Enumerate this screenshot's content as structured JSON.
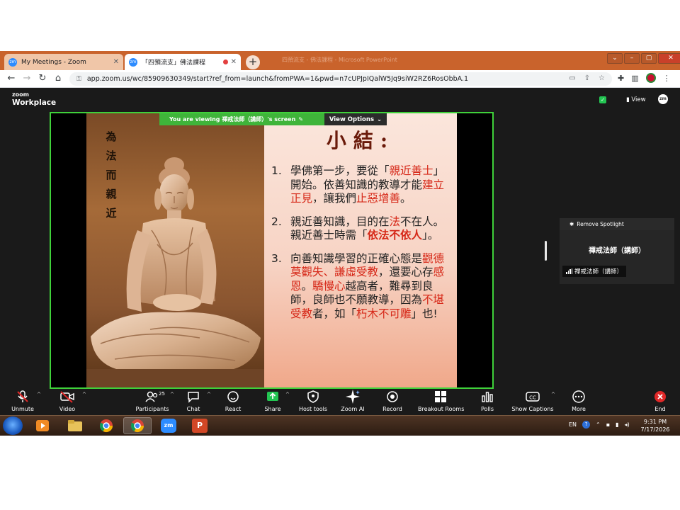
{
  "browser": {
    "tabs": [
      {
        "label": "My Meetings - Zoom",
        "favicon": "zm",
        "active": false
      },
      {
        "label": "「四預流支」佛法課程",
        "favicon": "zm",
        "active": true
      }
    ],
    "window_title": "四預流支 - 佛法課程 - Microsoft PowerPoint",
    "url": "app.zoom.us/wc/85909630349/start?ref_from=launch&fromPWA=1&pwd=n7cUPJpIQalW5Jq9siW2RZ6RosObbA.1"
  },
  "zoom_header": {
    "brand_top": "zoom",
    "brand_bottom": "Workplace",
    "view_label": "View",
    "badge": "zm"
  },
  "share": {
    "viewing_banner": "You are viewing 禪戒法師（講師）'s screen",
    "view_options": "View Options"
  },
  "slide": {
    "vertical_text": [
      "為",
      "法",
      "而",
      "親",
      "近"
    ],
    "title": "小結:",
    "items": [
      {
        "num": "1.",
        "runs": [
          {
            "t": "學佛第一步，要從「",
            "c": "black"
          },
          {
            "t": "親近善士",
            "c": "red"
          },
          {
            "t": "」開始。依善知識的教導才能",
            "c": "black"
          },
          {
            "t": "建立正見",
            "c": "red"
          },
          {
            "t": "，讓我們",
            "c": "black"
          },
          {
            "t": "止惡增善",
            "c": "red"
          },
          {
            "t": "。",
            "c": "black"
          }
        ]
      },
      {
        "num": "2.",
        "runs": [
          {
            "t": "親近善知識，目的在",
            "c": "black"
          },
          {
            "t": "法",
            "c": "red"
          },
          {
            "t": "不在人。親近善士時需「",
            "c": "black"
          },
          {
            "t": "依法不依人",
            "c": "redb"
          },
          {
            "t": "」。",
            "c": "black"
          }
        ]
      },
      {
        "num": "3.",
        "runs": [
          {
            "t": "向善知識學習的正確心態是",
            "c": "black"
          },
          {
            "t": "觀德莫觀失、謙虛受教",
            "c": "red"
          },
          {
            "t": "，還要心存",
            "c": "black"
          },
          {
            "t": "感恩",
            "c": "red"
          },
          {
            "t": "。",
            "c": "black"
          },
          {
            "t": "驕慢心",
            "c": "red"
          },
          {
            "t": "越高者，難尋到良師，良師也不願教導，因為",
            "c": "black"
          },
          {
            "t": "不堪受教",
            "c": "red"
          },
          {
            "t": "者，如「",
            "c": "black"
          },
          {
            "t": "朽木不可雕",
            "c": "red"
          },
          {
            "t": "」也!",
            "c": "black"
          }
        ]
      }
    ]
  },
  "spotlight": {
    "remove_label": "Remove Spotlight",
    "tile_name": "禪戒法師（講師）",
    "label_name": "禪戒法師（講師）"
  },
  "toolbar": {
    "participant_count": "25",
    "buttons": [
      {
        "id": "unmute",
        "label": "Unmute",
        "icon": "mic-muted-icon"
      },
      {
        "id": "video",
        "label": "Video",
        "icon": "video-off-icon"
      },
      {
        "id": "participants",
        "label": "Participants",
        "icon": "participants-icon"
      },
      {
        "id": "chat",
        "label": "Chat",
        "icon": "chat-icon"
      },
      {
        "id": "react",
        "label": "React",
        "icon": "react-icon"
      },
      {
        "id": "share",
        "label": "Share",
        "icon": "share-icon"
      },
      {
        "id": "host-tools",
        "label": "Host tools",
        "icon": "host-tools-icon"
      },
      {
        "id": "zoom-ai",
        "label": "Zoom AI",
        "icon": "zoom-ai-icon"
      },
      {
        "id": "record",
        "label": "Record",
        "icon": "record-icon"
      },
      {
        "id": "breakout",
        "label": "Breakout Rooms",
        "icon": "breakout-icon"
      },
      {
        "id": "polls",
        "label": "Polls",
        "icon": "polls-icon"
      },
      {
        "id": "captions",
        "label": "Show Captions",
        "icon": "captions-icon"
      },
      {
        "id": "more",
        "label": "More",
        "icon": "more-icon"
      },
      {
        "id": "end",
        "label": "End",
        "icon": "end-icon"
      }
    ]
  },
  "taskbar": {
    "apps": [
      "media-player-icon",
      "file-explorer-icon",
      "chrome-icon",
      "chrome-active-icon",
      "zoom-taskbar-icon",
      "powerpoint-icon"
    ],
    "zoom_label": "zm",
    "ppt_label": "P",
    "lang": "EN",
    "time": "9:31 PM",
    "date": "7/17/2026"
  },
  "colors": {
    "tab_strip": "#c9632c",
    "zoom_bg": "#1a1a1a",
    "share_border": "#3fd13a",
    "slide_red": "#d62818",
    "title_color": "#6a1a0a"
  }
}
